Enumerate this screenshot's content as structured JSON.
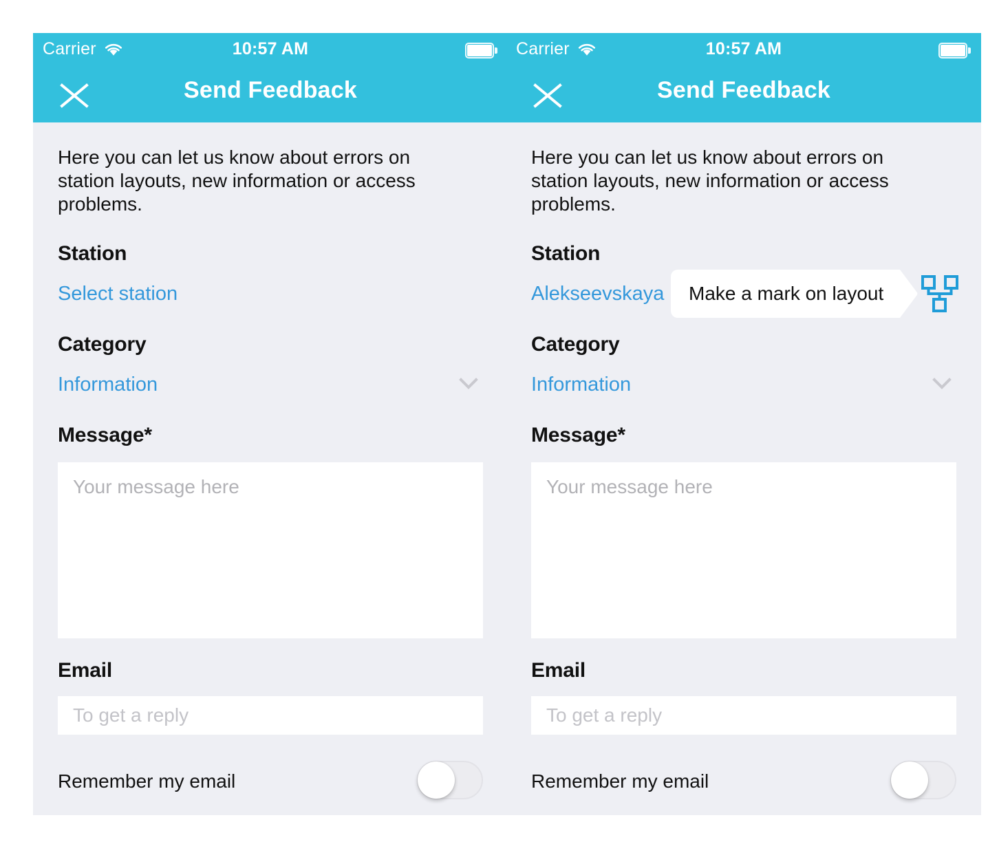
{
  "theme": {
    "header_color": "#33c0dd",
    "page_background": "#eeeff4",
    "link_color": "#3498db",
    "text_color": "#111111",
    "placeholder_color": "#b2b2b6",
    "field_background": "#ffffff",
    "icon_blue": "#1f9cd8"
  },
  "status_bar": {
    "carrier": "Carrier",
    "time": "10:57 AM",
    "wifi_icon": "wifi-icon",
    "battery_icon": "battery-icon"
  },
  "nav": {
    "close_icon": "close-icon",
    "title": "Send Feedback"
  },
  "form": {
    "intro": "Here you can let us know about errors on station layouts, new information or access problems.",
    "station": {
      "label": "Station",
      "placeholder": "Select station",
      "selected": "Alekseevskaya"
    },
    "category": {
      "label": "Category",
      "value": "Information",
      "chevron_icon": "chevron-down-icon"
    },
    "message": {
      "label": "Message*",
      "placeholder": "Your message here",
      "value": ""
    },
    "email": {
      "label": "Email",
      "placeholder": "To get a reply",
      "value": ""
    },
    "remember": {
      "label": "Remember my email",
      "state": "off"
    }
  },
  "tooltip": {
    "text": "Make a mark on layout",
    "layout_icon": "layout-map-icon"
  },
  "panels": [
    {
      "id": "left",
      "state": "empty-station"
    },
    {
      "id": "right",
      "state": "station-selected-with-tooltip"
    }
  ]
}
